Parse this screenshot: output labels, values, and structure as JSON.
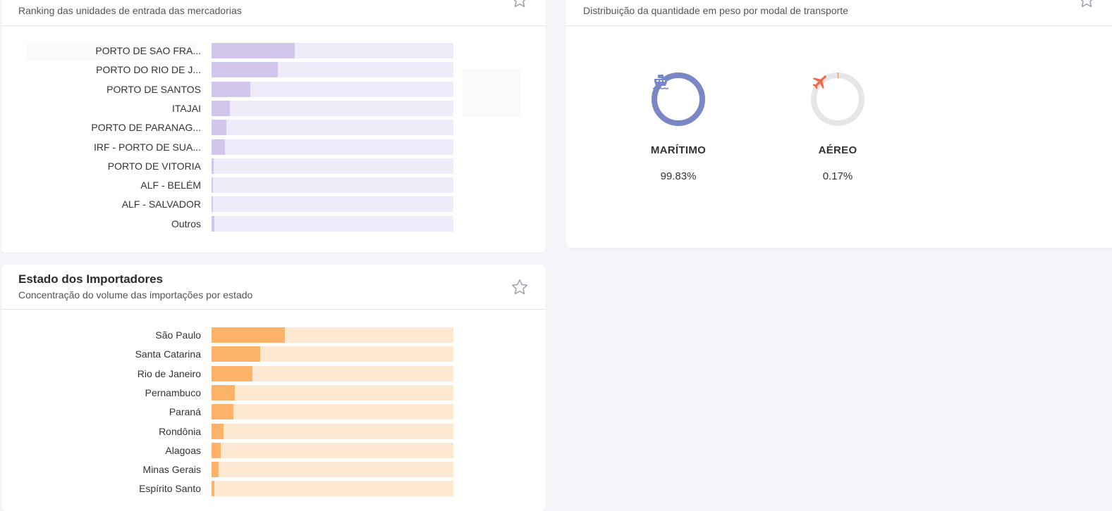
{
  "ports": {
    "subtitle": "Ranking das unidades de entrada das mercadorias",
    "colors": {
      "fill": "#d3c6ec",
      "track": "#f0ebf8"
    }
  },
  "modal": {
    "subtitle": "Distribuição da quantidade em peso por modal de transporte",
    "items": [
      {
        "label": "MARÍTIMO",
        "percent": "99.83%",
        "share": 0.9983,
        "color": "#7b86c7",
        "icon": "ship-icon"
      },
      {
        "label": "AÉREO",
        "percent": "0.17%",
        "share": 0.0017,
        "color": "#f06a45",
        "icon": "airplane-icon"
      }
    ],
    "ring_track_color": "#e6e6e6"
  },
  "states": {
    "title": "Estado dos Importadores",
    "subtitle": "Concentração do volume das importações por estado",
    "colors": {
      "fill": "#fdb26a",
      "track": "#fde8d2"
    }
  },
  "chart_data": [
    {
      "type": "bar",
      "orientation": "horizontal",
      "categories": [
        "PORTO DE SAO FRA...",
        "PORTO DO RIO DE J...",
        "PORTO DE SANTOS",
        "ITAJAI",
        "PORTO DE PARANAG...",
        "IRF - PORTO DE SUA...",
        "PORTO DE VITORIA",
        "ALF - BELÉM",
        "ALF - SALVADOR",
        "Outros"
      ],
      "values": [
        34.5,
        27.5,
        16,
        7.5,
        6.2,
        5.5,
        1,
        0.6,
        0.6,
        1.2
      ],
      "value_unit": "percent of max bar width",
      "xlim": [
        0,
        100
      ]
    },
    {
      "type": "bar",
      "orientation": "horizontal",
      "categories": [
        "São Paulo",
        "Santa Catarina",
        "Rio de Janeiro",
        "Pernambuco",
        "Paraná",
        "Rondônia",
        "Alagoas",
        "Minas Gerais",
        "Espírito Santo"
      ],
      "values": [
        30.3,
        20,
        16.8,
        9.5,
        9.1,
        5,
        3.9,
        3,
        1.3
      ],
      "value_unit": "percent of max bar width",
      "xlim": [
        0,
        100
      ]
    }
  ]
}
